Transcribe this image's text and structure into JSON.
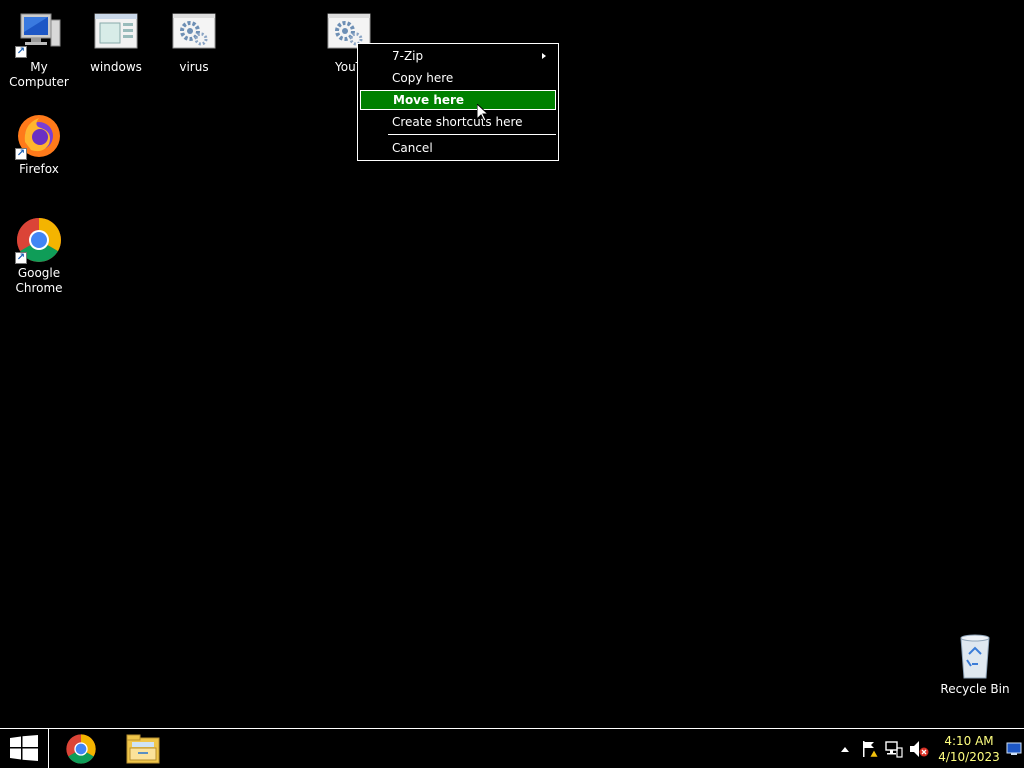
{
  "desktop": {
    "icons": [
      {
        "label": "My Computer"
      },
      {
        "label": "windows"
      },
      {
        "label": "virus"
      },
      {
        "label": "YouT"
      },
      {
        "label": "Firefox"
      },
      {
        "label": "Google Chrome"
      },
      {
        "label": "Recycle Bin"
      }
    ]
  },
  "context_menu": {
    "items": [
      {
        "label": "7-Zip",
        "has_submenu": true
      },
      {
        "label": "Copy here"
      },
      {
        "label": "Move here",
        "highlighted": true
      },
      {
        "label": "Create shortcuts here"
      },
      {
        "label": "Cancel"
      }
    ]
  },
  "taskbar": {
    "start_icon": "windows-logo-icon",
    "pinned": [
      {
        "name": "chrome-icon"
      },
      {
        "name": "file-explorer-icon"
      }
    ],
    "tray_icons": [
      "show-hidden-icons-chevron",
      "action-center-flag-icon",
      "network-icon",
      "volume-muted-icon",
      "show-desktop-icon"
    ],
    "clock": {
      "time": "4:10 AM",
      "date": "4/10/2023"
    }
  },
  "colors": {
    "highlight": "#008000",
    "clock_text": "#ffff80",
    "background": "#000000"
  }
}
